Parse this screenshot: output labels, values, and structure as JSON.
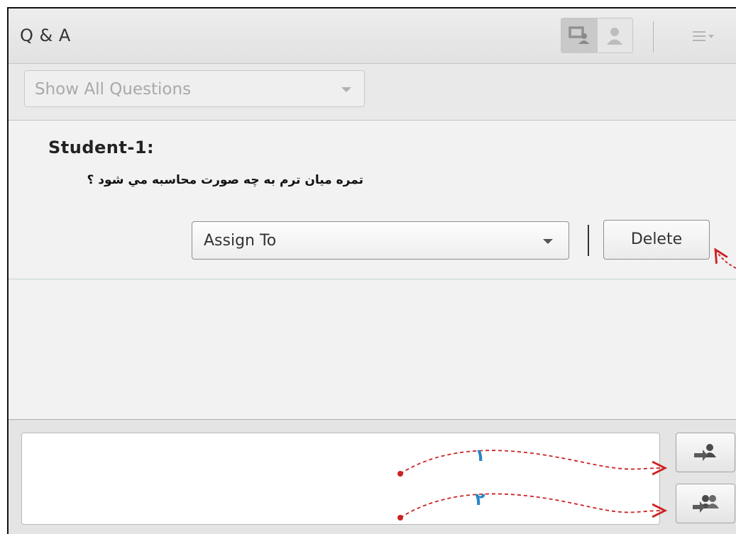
{
  "header": {
    "title": "Q & A",
    "view_toggle": [
      {
        "icon": "presenter-view-icon",
        "active": true
      },
      {
        "icon": "participant-view-icon",
        "active": false
      }
    ],
    "menu_icon": "menu-icon"
  },
  "filter": {
    "selected": "Show All Questions"
  },
  "question": {
    "author": "Student-1:",
    "text": "تمره ميان ترم به چه صورت محاسبه مي شود ؟",
    "assign_label": "Assign To",
    "delete_label": "Delete"
  },
  "compose": {
    "value": "",
    "send_private_icon": "send-to-presenter-icon",
    "send_all_icon": "send-to-all-icon"
  },
  "annotations": {
    "label_1": "١",
    "label_2": "٢",
    "arrow_color": "#cc2222",
    "number_color": "#2a86c8"
  }
}
